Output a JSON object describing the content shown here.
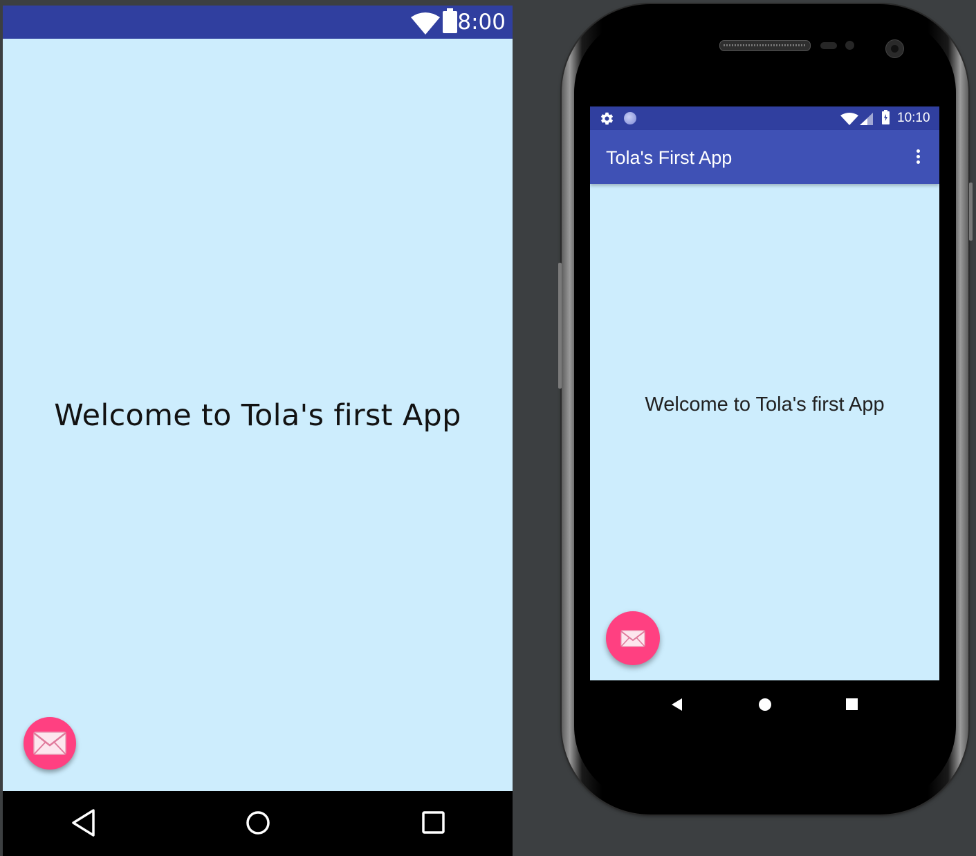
{
  "design_preview": {
    "status_bar": {
      "time": "8:00"
    },
    "content": {
      "welcome_text": "Welcome to Tola's first App"
    },
    "fab": {
      "icon": "email-icon"
    },
    "nav_bar": {
      "buttons": [
        "back-icon",
        "home-icon",
        "recents-icon"
      ]
    }
  },
  "emulator": {
    "status_bar": {
      "time": "10:10",
      "icons": [
        "settings-gear-icon",
        "sync-icon",
        "wifi-icon",
        "signal-icon",
        "battery-charging-icon"
      ]
    },
    "app_bar": {
      "title": "Tola's First App",
      "menu_icon": "overflow-menu-icon"
    },
    "content": {
      "welcome_text": "Welcome to Tola's first App"
    },
    "fab": {
      "icon": "email-icon"
    },
    "nav_bar": {
      "buttons": [
        "back-icon",
        "home-icon",
        "recents-icon"
      ]
    }
  },
  "colors": {
    "status_bar": "#303F9F",
    "app_bar": "#3F51B5",
    "content_background": "#CDEDFD",
    "fab_accent": "#FF4081",
    "ide_background": "#3C3F41"
  }
}
